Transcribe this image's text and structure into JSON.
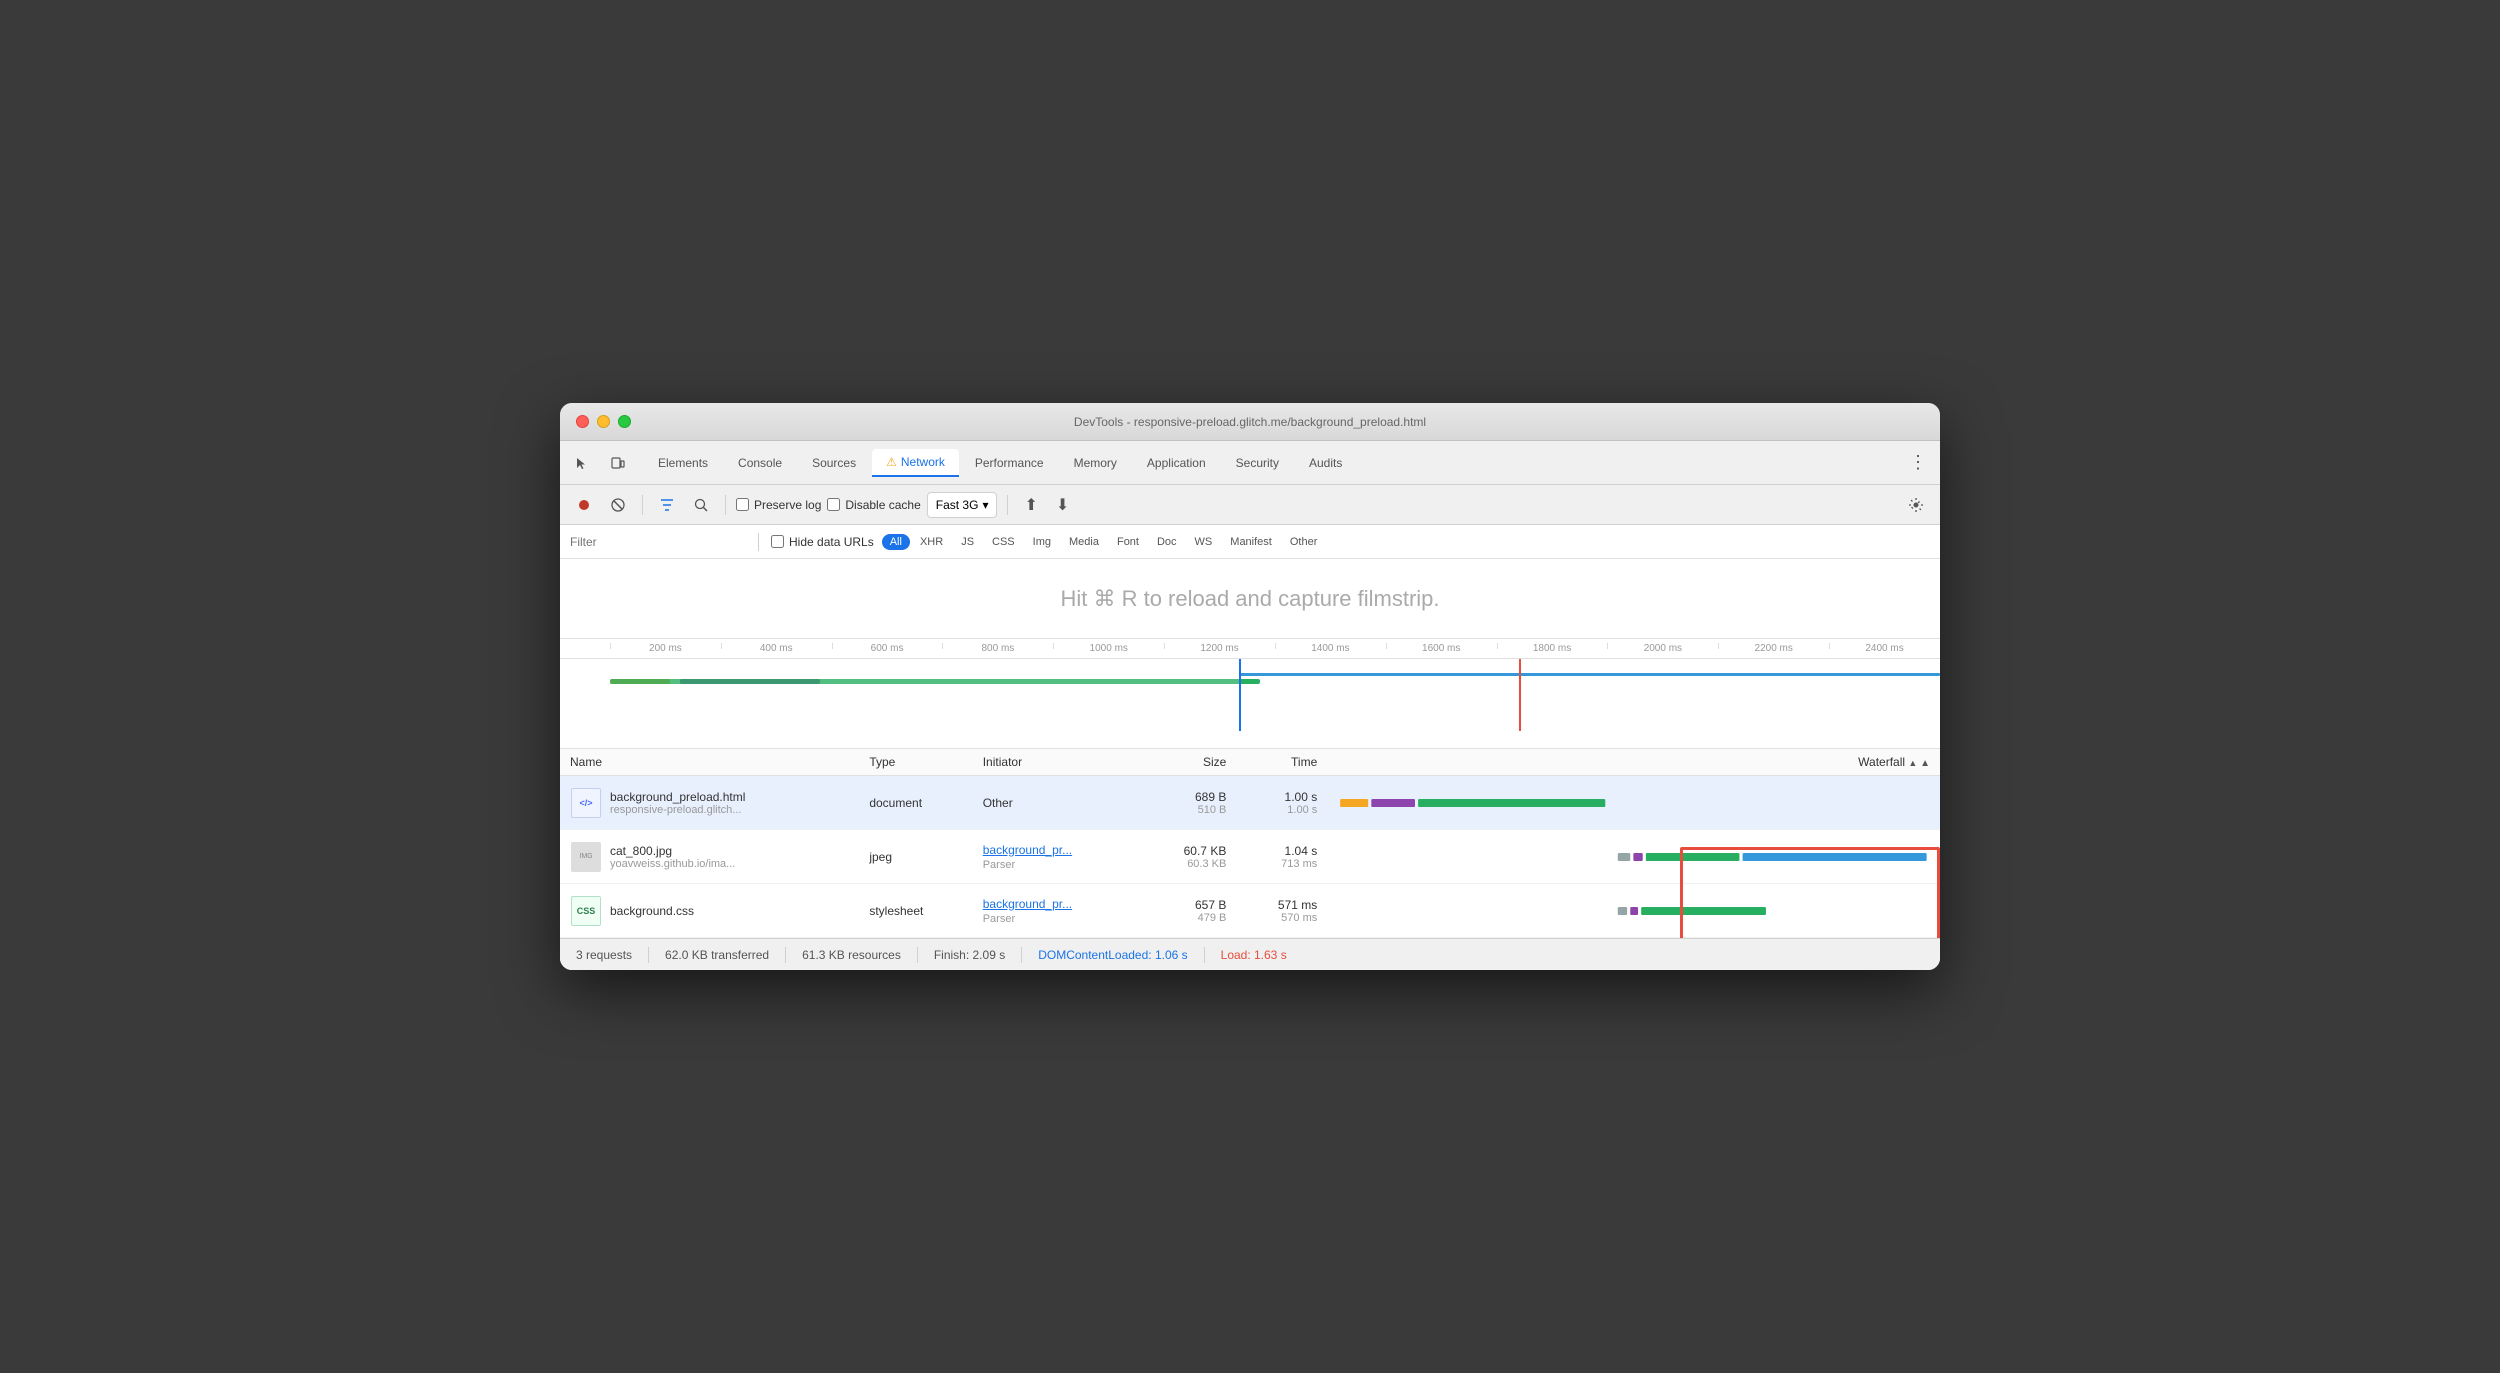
{
  "window": {
    "title": "DevTools - responsive-preload.glitch.me/background_preload.html"
  },
  "tabs": [
    {
      "label": "Elements",
      "active": false
    },
    {
      "label": "Console",
      "active": false
    },
    {
      "label": "Sources",
      "active": false
    },
    {
      "label": "Network",
      "active": true,
      "warning": true
    },
    {
      "label": "Performance",
      "active": false
    },
    {
      "label": "Memory",
      "active": false
    },
    {
      "label": "Application",
      "active": false
    },
    {
      "label": "Security",
      "active": false
    },
    {
      "label": "Audits",
      "active": false
    }
  ],
  "toolbar": {
    "preserve_log": "Preserve log",
    "disable_cache": "Disable cache",
    "throttle": "Fast 3G"
  },
  "filter": {
    "placeholder": "Filter",
    "hide_data_urls": "Hide data URLs",
    "types": [
      "All",
      "XHR",
      "JS",
      "CSS",
      "Img",
      "Media",
      "Font",
      "Doc",
      "WS",
      "Manifest",
      "Other"
    ]
  },
  "filmstrip": {
    "hint": "Hit ⌘ R to reload and capture filmstrip."
  },
  "timeline": {
    "ticks": [
      "200 ms",
      "400 ms",
      "600 ms",
      "800 ms",
      "1000 ms",
      "1200 ms",
      "1400 ms",
      "1600 ms",
      "1800 ms",
      "2000 ms",
      "2200 ms",
      "2400 ms"
    ]
  },
  "table": {
    "headers": [
      "Name",
      "Type",
      "Initiator",
      "Size",
      "Time",
      "Waterfall"
    ],
    "rows": [
      {
        "name": "background_preload.html",
        "domain": "responsive-preload.glitch...",
        "type": "document",
        "initiator": "Other",
        "initiator_link": false,
        "size": "689 B",
        "size2": "510 B",
        "time": "1.00 s",
        "time2": "1.00 s",
        "selected": true,
        "icon_type": "html"
      },
      {
        "name": "cat_800.jpg",
        "domain": "yoavweiss.github.io/ima...",
        "type": "jpeg",
        "initiator": "background_pr...",
        "initiator2": "Parser",
        "initiator_link": true,
        "size": "60.7 KB",
        "size2": "60.3 KB",
        "time": "1.04 s",
        "time2": "713 ms",
        "selected": false,
        "icon_type": "img"
      },
      {
        "name": "background.css",
        "domain": "",
        "type": "stylesheet",
        "initiator": "background_pr...",
        "initiator2": "Parser",
        "initiator_link": true,
        "size": "657 B",
        "size2": "479 B",
        "time": "571 ms",
        "time2": "570 ms",
        "selected": false,
        "icon_type": "css"
      }
    ]
  },
  "status_bar": {
    "requests": "3 requests",
    "transferred": "62.0 KB transferred",
    "resources": "61.3 KB resources",
    "finish": "Finish: 2.09 s",
    "dom_loaded": "DOMContentLoaded: 1.06 s",
    "load": "Load: 1.63 s"
  }
}
